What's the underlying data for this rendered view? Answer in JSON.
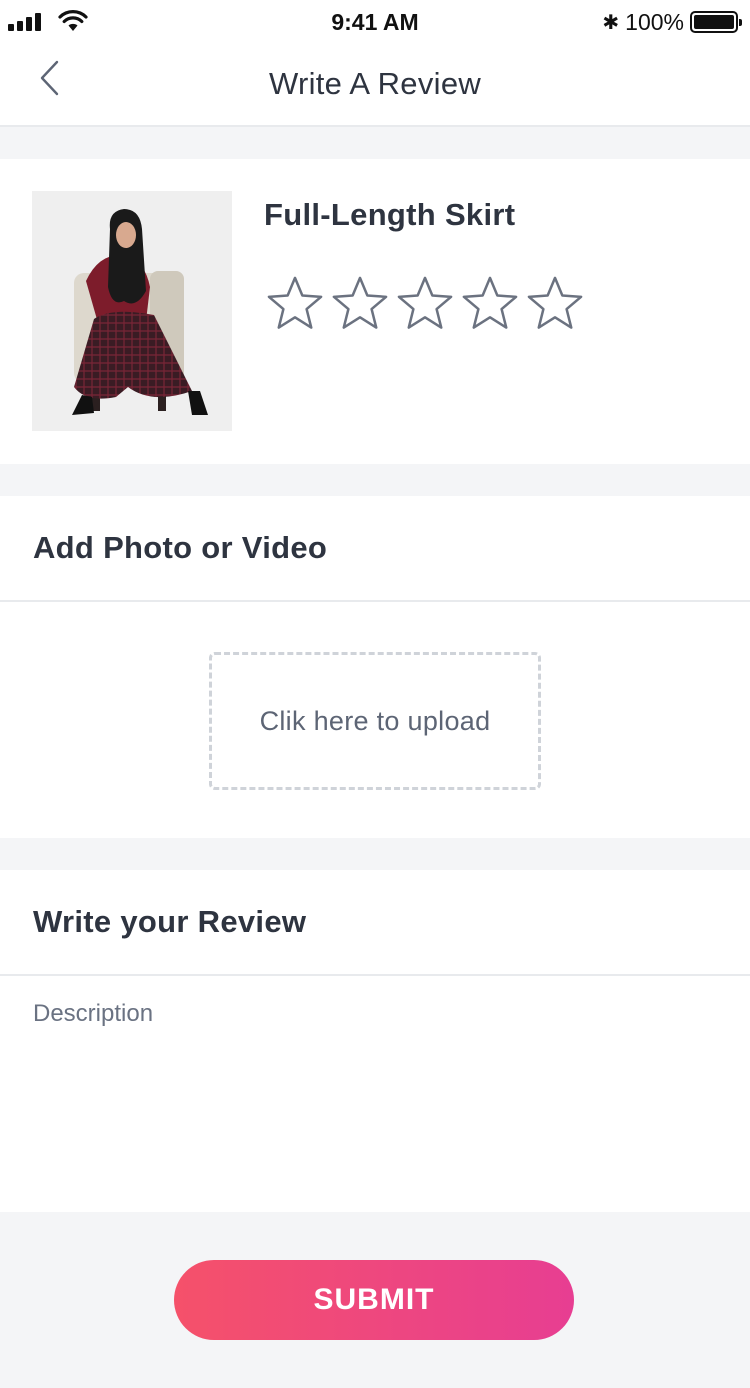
{
  "status_bar": {
    "time": "9:41 AM",
    "battery": "100%"
  },
  "nav": {
    "title": "Write A Review"
  },
  "product": {
    "name": "Full-Length Skirt",
    "rating": 0,
    "rating_max": 5
  },
  "media_section": {
    "title": "Add Photo or Video",
    "upload_label": "Clik here to upload"
  },
  "review_section": {
    "title": "Write your Review",
    "description_placeholder": "Description"
  },
  "submit_label": "SUBMIT",
  "colors": {
    "accent_start": "#f5516a",
    "accent_end": "#e73e92",
    "star_outline": "#6b7280"
  }
}
